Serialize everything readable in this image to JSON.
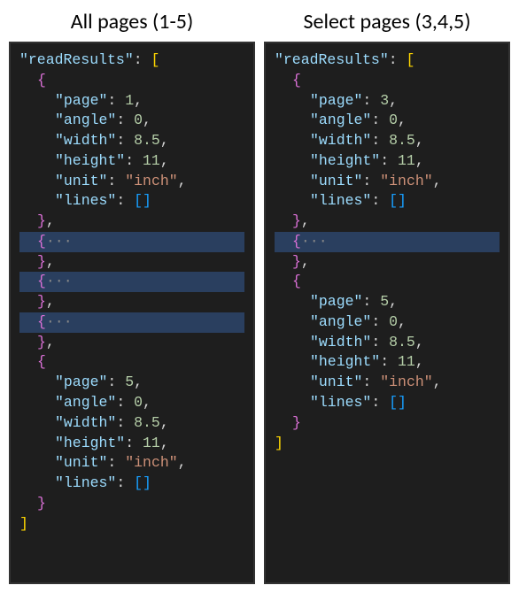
{
  "left": {
    "title": "All pages (1-5)",
    "rootKey": "\"readResults\"",
    "firstPage": {
      "page": "1",
      "angle": "0",
      "width": "8.5",
      "height": "11",
      "unit": "\"inch\"",
      "linesLabel": "\"lines\"",
      "pageLabel": "\"page\"",
      "angleLabel": "\"angle\"",
      "widthLabel": "\"width\"",
      "heightLabel": "\"height\"",
      "unitLabel": "\"unit\""
    },
    "lastPage": {
      "page": "5",
      "angle": "0",
      "width": "8.5",
      "height": "11",
      "unit": "\"inch\"",
      "linesLabel": "\"lines\"",
      "pageLabel": "\"page\"",
      "angleLabel": "\"angle\"",
      "widthLabel": "\"width\"",
      "heightLabel": "\"height\"",
      "unitLabel": "\"unit\""
    },
    "collapsedCount": 3
  },
  "right": {
    "title": "Select pages (3,4,5)",
    "rootKey": "\"readResults\"",
    "firstPage": {
      "page": "3",
      "angle": "0",
      "width": "8.5",
      "height": "11",
      "unit": "\"inch\"",
      "linesLabel": "\"lines\"",
      "pageLabel": "\"page\"",
      "angleLabel": "\"angle\"",
      "widthLabel": "\"width\"",
      "heightLabel": "\"height\"",
      "unitLabel": "\"unit\""
    },
    "lastPage": {
      "page": "5",
      "angle": "0",
      "width": "8.5",
      "height": "11",
      "unit": "\"inch\"",
      "linesLabel": "\"lines\"",
      "pageLabel": "\"page\"",
      "angleLabel": "\"angle\"",
      "widthLabel": "\"width\"",
      "heightLabel": "\"height\"",
      "unitLabel": "\"unit\""
    },
    "collapsedCount": 1
  },
  "symbols": {
    "openBracket": "[",
    "closeBracket": "]",
    "openBrace": "{",
    "closeBrace": "}",
    "colon": ": ",
    "comma": ",",
    "dots": "···",
    "emptyArr": "[]"
  }
}
